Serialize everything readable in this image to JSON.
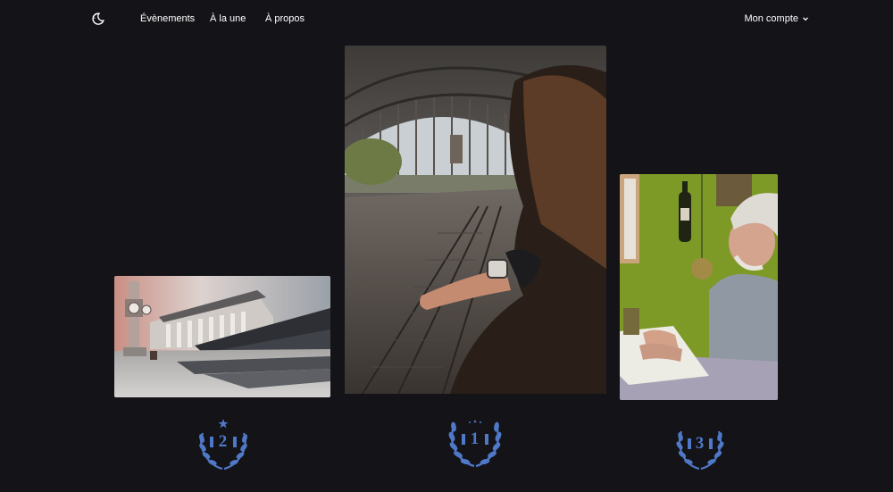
{
  "nav": {
    "links": [
      "Évènements",
      "À la une",
      "À propos"
    ],
    "account_label": "Mon compte"
  },
  "icons": {
    "logo": "moon-stars-icon",
    "account_chevron": "chevron-down-icon",
    "medal": "laurel-wreath-icon"
  },
  "colors": {
    "background": "#141318",
    "accent": "#4f78c6",
    "text": "#ffffff"
  },
  "podium": [
    {
      "rank": "2",
      "photo": "bordeaux-grand-theatre"
    },
    {
      "rank": "1",
      "photo": "woman-watch-train-station"
    },
    {
      "rank": "3",
      "photo": "old-man-reading-kitchen"
    }
  ]
}
